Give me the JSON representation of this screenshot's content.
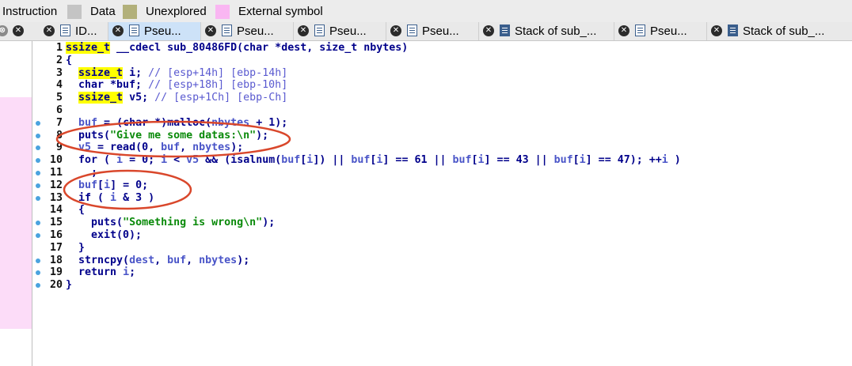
{
  "legend": [
    {
      "label": "Instruction",
      "color": null
    },
    {
      "label": "Data",
      "color": "#c4c4c4"
    },
    {
      "label": "Unexplored",
      "color": "#b2b07a"
    },
    {
      "label": "External symbol",
      "color": "#f9b6f2"
    }
  ],
  "tabs": [
    {
      "label": "ID...",
      "icon": "view-icon",
      "active": false
    },
    {
      "label": "Pseu...",
      "icon": "pseudocode-icon",
      "active": true
    },
    {
      "label": "Pseu...",
      "icon": "pseudocode-icon",
      "active": false
    },
    {
      "label": "Pseu...",
      "icon": "pseudocode-icon",
      "active": false
    },
    {
      "label": "Pseu...",
      "icon": "pseudocode-icon",
      "active": false
    },
    {
      "label": "Stack of sub_...",
      "icon": "stack-icon",
      "active": false
    },
    {
      "label": "Pseu...",
      "icon": "pseudocode-icon",
      "active": false
    },
    {
      "label": "Stack of sub_...",
      "icon": "stack-icon",
      "active": false
    }
  ],
  "colors": {
    "annotation": "#d9472b",
    "keyword": "#00008b",
    "variable": "#4a55c8",
    "string": "#0a8a0a",
    "highlight": "#ffff00",
    "breakpoint_dot": "#4aa3df"
  },
  "code_lines": [
    {
      "n": "1",
      "dot": false,
      "tokens": [
        [
          "typ",
          "ssize_t"
        ],
        [
          "plain",
          " __cdecl sub_80486FD(char *dest, size_t nbytes)"
        ]
      ]
    },
    {
      "n": "2",
      "dot": false,
      "tokens": [
        [
          "plain",
          "{"
        ]
      ]
    },
    {
      "n": "3",
      "dot": false,
      "tokens": [
        [
          "plain",
          "  "
        ],
        [
          "typ",
          "ssize_t"
        ],
        [
          "plain",
          " i; "
        ],
        [
          "com",
          "// [esp+14h] [ebp-14h]"
        ]
      ]
    },
    {
      "n": "4",
      "dot": false,
      "tokens": [
        [
          "plain",
          "  char *buf; "
        ],
        [
          "com",
          "// [esp+18h] [ebp-10h]"
        ]
      ]
    },
    {
      "n": "5",
      "dot": false,
      "tokens": [
        [
          "plain",
          "  "
        ],
        [
          "typ",
          "ssize_t"
        ],
        [
          "plain",
          " v5; "
        ],
        [
          "com",
          "// [esp+1Ch] [ebp-Ch]"
        ]
      ]
    },
    {
      "n": "6",
      "dot": false,
      "tokens": [
        [
          "plain",
          ""
        ]
      ]
    },
    {
      "n": "7",
      "dot": true,
      "tokens": [
        [
          "plain",
          "  "
        ],
        [
          "var",
          "buf"
        ],
        [
          "plain",
          " = (char *)malloc("
        ],
        [
          "var",
          "nbytes"
        ],
        [
          "plain",
          " + 1);"
        ]
      ]
    },
    {
      "n": "8",
      "dot": true,
      "tokens": [
        [
          "plain",
          "  puts("
        ],
        [
          "str",
          "\"Give me some datas:\\n\""
        ],
        [
          "plain",
          ");"
        ]
      ]
    },
    {
      "n": "9",
      "dot": true,
      "tokens": [
        [
          "plain",
          "  "
        ],
        [
          "var",
          "v5"
        ],
        [
          "plain",
          " = read(0, "
        ],
        [
          "var",
          "buf"
        ],
        [
          "plain",
          ", "
        ],
        [
          "var",
          "nbytes"
        ],
        [
          "plain",
          ");"
        ]
      ]
    },
    {
      "n": "10",
      "dot": true,
      "tokens": [
        [
          "plain",
          "  for ( "
        ],
        [
          "var",
          "i"
        ],
        [
          "plain",
          " = 0; "
        ],
        [
          "var",
          "i"
        ],
        [
          "plain",
          " < "
        ],
        [
          "var",
          "v5"
        ],
        [
          "plain",
          " && (isalnum("
        ],
        [
          "var",
          "buf"
        ],
        [
          "plain",
          "["
        ],
        [
          "var",
          "i"
        ],
        [
          "plain",
          "]) || "
        ],
        [
          "var",
          "buf"
        ],
        [
          "plain",
          "["
        ],
        [
          "var",
          "i"
        ],
        [
          "plain",
          "] == 61 || "
        ],
        [
          "var",
          "buf"
        ],
        [
          "plain",
          "["
        ],
        [
          "var",
          "i"
        ],
        [
          "plain",
          "] == 43 || "
        ],
        [
          "var",
          "buf"
        ],
        [
          "plain",
          "["
        ],
        [
          "var",
          "i"
        ],
        [
          "plain",
          "] == 47); ++"
        ],
        [
          "var",
          "i"
        ],
        [
          "plain",
          " )"
        ]
      ]
    },
    {
      "n": "11",
      "dot": true,
      "tokens": [
        [
          "plain",
          "    ;"
        ]
      ]
    },
    {
      "n": "12",
      "dot": true,
      "tokens": [
        [
          "plain",
          "  "
        ],
        [
          "var",
          "buf"
        ],
        [
          "plain",
          "["
        ],
        [
          "var",
          "i"
        ],
        [
          "plain",
          "] = 0;"
        ]
      ]
    },
    {
      "n": "13",
      "dot": true,
      "tokens": [
        [
          "plain",
          "  if ( "
        ],
        [
          "var",
          "i"
        ],
        [
          "plain",
          " & 3 )"
        ]
      ]
    },
    {
      "n": "14",
      "dot": false,
      "tokens": [
        [
          "plain",
          "  {"
        ]
      ]
    },
    {
      "n": "15",
      "dot": true,
      "tokens": [
        [
          "plain",
          "    puts("
        ],
        [
          "str",
          "\"Something is wrong\\n\""
        ],
        [
          "plain",
          ");"
        ]
      ]
    },
    {
      "n": "16",
      "dot": true,
      "tokens": [
        [
          "plain",
          "    exit(0);"
        ]
      ]
    },
    {
      "n": "17",
      "dot": false,
      "tokens": [
        [
          "plain",
          "  }"
        ]
      ]
    },
    {
      "n": "18",
      "dot": true,
      "tokens": [
        [
          "plain",
          "  strncpy("
        ],
        [
          "var",
          "dest"
        ],
        [
          "plain",
          ", "
        ],
        [
          "var",
          "buf"
        ],
        [
          "plain",
          ", "
        ],
        [
          "var",
          "nbytes"
        ],
        [
          "plain",
          ");"
        ]
      ]
    },
    {
      "n": "19",
      "dot": true,
      "tokens": [
        [
          "plain",
          "  return "
        ],
        [
          "var",
          "i"
        ],
        [
          "plain",
          ";"
        ]
      ]
    },
    {
      "n": "20",
      "dot": true,
      "tokens": [
        [
          "plain",
          "}"
        ]
      ]
    }
  ]
}
